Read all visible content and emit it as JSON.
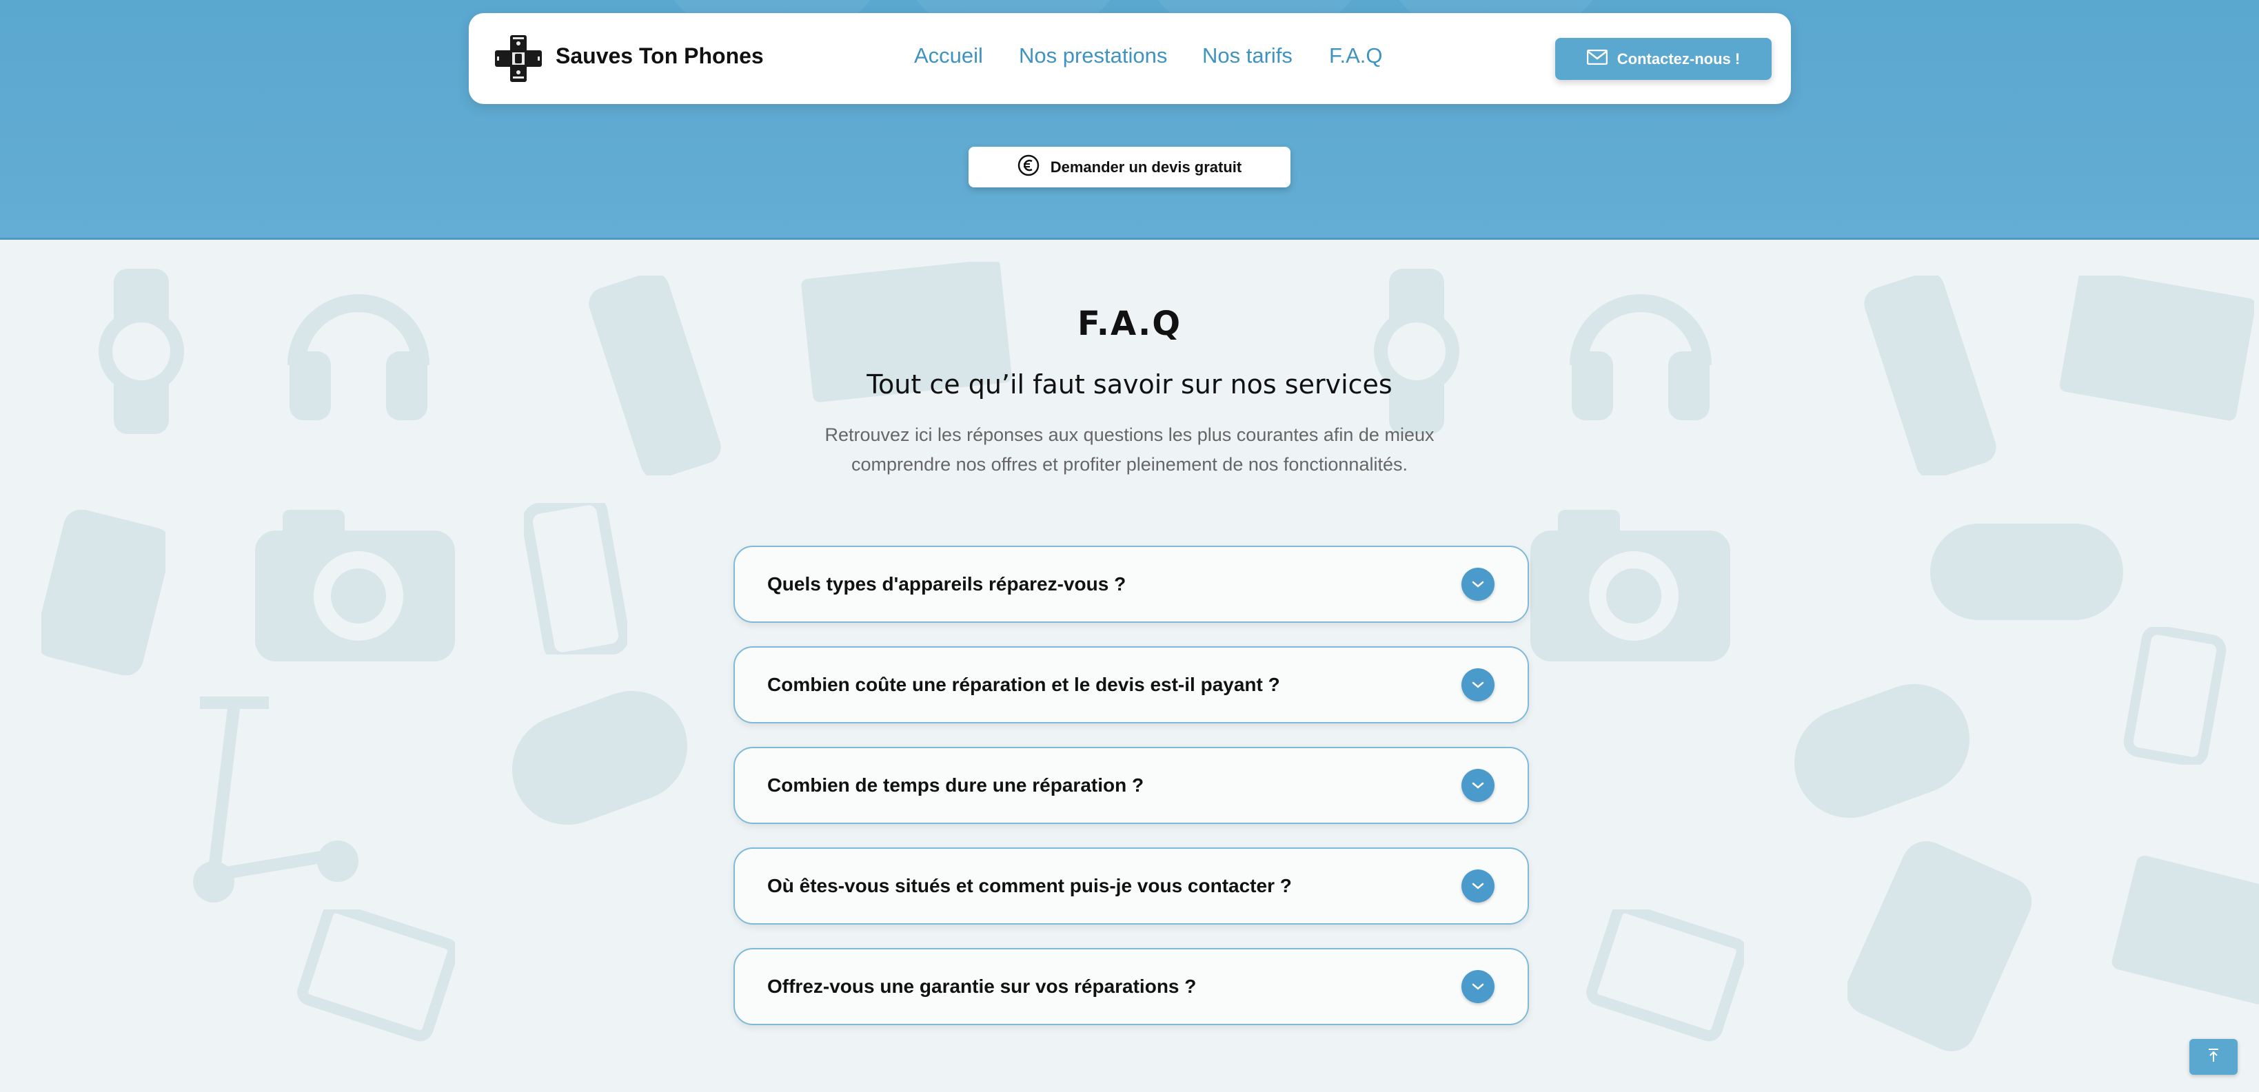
{
  "header": {
    "brand_name": "Sauves Ton Phones",
    "nav": [
      {
        "label": "Accueil"
      },
      {
        "label": "Nos prestations"
      },
      {
        "label": "Nos tarifs"
      },
      {
        "label": "F.A.Q"
      }
    ],
    "contact_label": "Contactez-nous !",
    "quote_label": "Demander un devis gratuit"
  },
  "faq": {
    "title": "F.A.Q",
    "subtitle": "Tout ce qu’il faut savoir sur nos services",
    "description_line1": "Retrouvez ici les réponses aux questions les plus courantes afin de mieux",
    "description_line2": "comprendre nos offres et profiter pleinement de nos fonctionnalités.",
    "items": [
      {
        "question": "Quels types d'appareils réparez-vous ?"
      },
      {
        "question": "Combien coûte une réparation et le devis est-il payant ?"
      },
      {
        "question": "Combien de temps dure une réparation ?"
      },
      {
        "question": "Où êtes-vous situés et comment puis-je vous contacter ?"
      },
      {
        "question": "Offrez-vous une garantie sur vos réparations ?"
      }
    ]
  },
  "icons": {
    "logo": "phone-repair-cross-logo",
    "contact": "envelope-icon",
    "quote": "euro-icon",
    "faq_toggle": "chevron-down-icon",
    "scroll_top": "arrow-up-icon"
  },
  "colors": {
    "accent": "#5aa7d0",
    "link": "#3f93c2",
    "border": "#7fb9d8"
  }
}
